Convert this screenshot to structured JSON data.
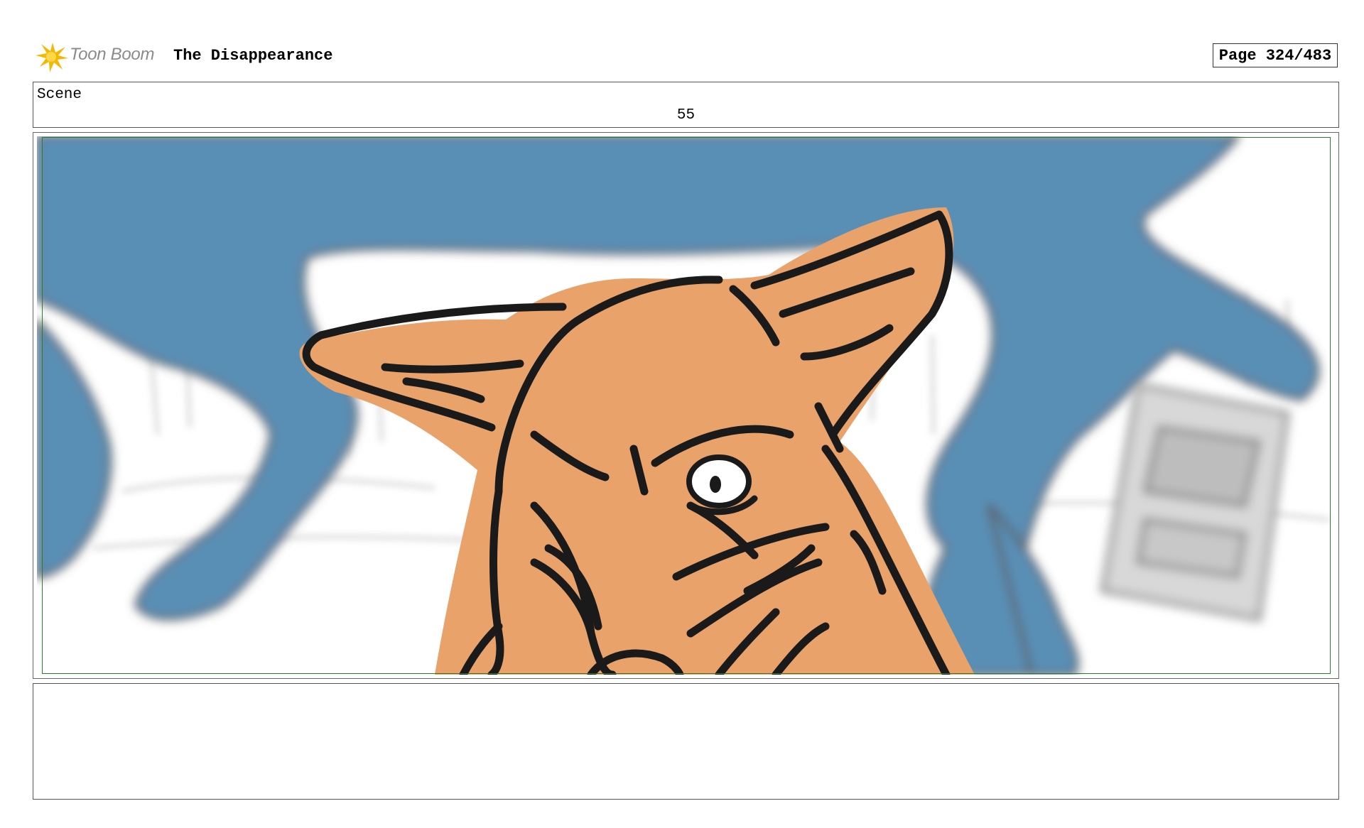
{
  "header": {
    "logo_text": "Toon Boom",
    "project_title": "The Disappearance",
    "page_label": "Page 324/483"
  },
  "scene": {
    "label": "Scene",
    "number": "55"
  },
  "panel": {
    "description_visible": false,
    "colors": {
      "background_character": "#5a8fb5",
      "foreground_character": "#e8a26a",
      "line": "#1a1a1a",
      "safe_frame": "#2f7a2f"
    }
  },
  "notes": {
    "text": ""
  },
  "icons": {
    "logo": "toon-boom-starburst-icon"
  }
}
